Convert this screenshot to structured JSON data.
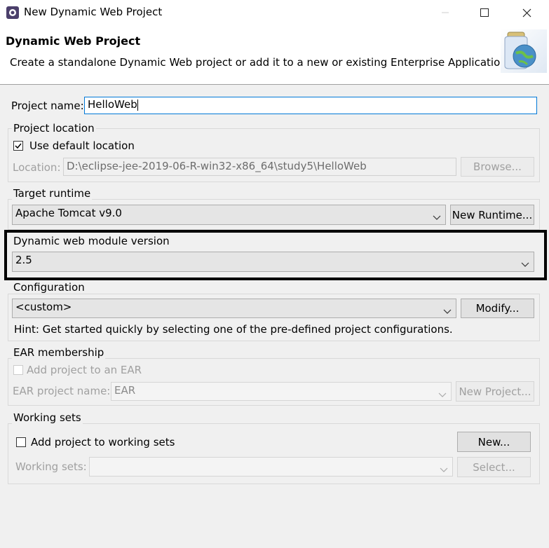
{
  "window": {
    "title": "New Dynamic Web Project",
    "minimize_icon": "minimize-icon",
    "maximize_icon": "maximize-icon",
    "close_icon": "close-icon"
  },
  "header": {
    "title": "Dynamic Web Project",
    "description": "Create a standalone Dynamic Web project or add it to a new or existing Enterprise Application."
  },
  "project_name": {
    "label": "Project name:",
    "value": "HelloWeb"
  },
  "project_location": {
    "group_label": "Project location",
    "use_default_label": "Use default location",
    "use_default_checked": true,
    "location_label": "Location:",
    "location_value": "D:\\eclipse-jee-2019-06-R-win32-x86_64\\study5\\HelloWeb",
    "browse_label": "Browse..."
  },
  "target_runtime": {
    "group_label": "Target runtime",
    "selected": "Apache Tomcat v9.0",
    "new_runtime_label": "New Runtime..."
  },
  "module_version": {
    "group_label": "Dynamic web module version",
    "selected": "2.5"
  },
  "configuration": {
    "group_label": "Configuration",
    "selected": "<custom>",
    "modify_label": "Modify...",
    "hint": "Hint: Get started quickly by selecting one of the pre-defined project configurations."
  },
  "ear": {
    "group_label": "EAR membership",
    "add_label": "Add project to an EAR",
    "add_checked": false,
    "project_name_label": "EAR project name:",
    "project_name_value": "EAR",
    "new_project_label": "New Project..."
  },
  "working_sets": {
    "group_label": "Working sets",
    "add_label": "Add project to working sets",
    "add_checked": false,
    "new_label": "New...",
    "sets_label": "Working sets:",
    "sets_value": "",
    "select_label": "Select..."
  }
}
